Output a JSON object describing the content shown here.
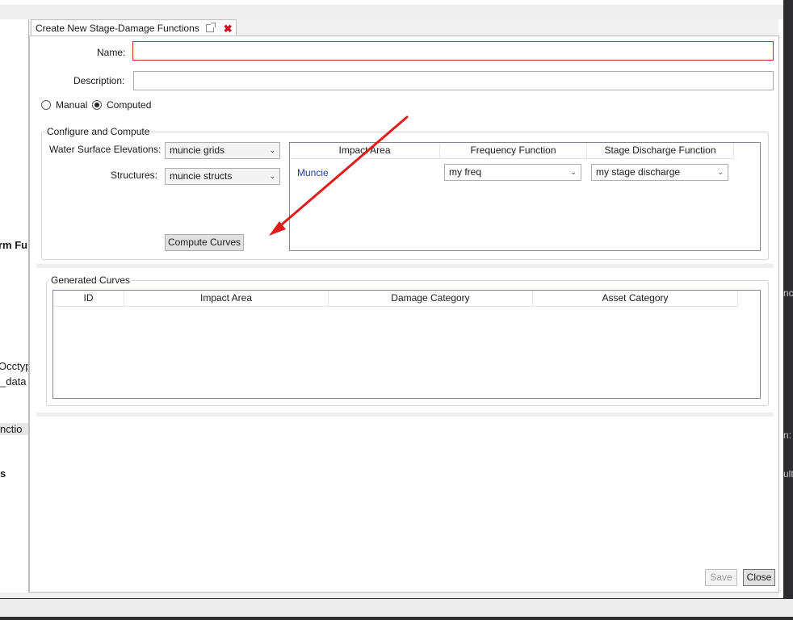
{
  "tab": {
    "title": "Create New Stage-Damage Functions"
  },
  "form": {
    "name_label": "Name:",
    "name_value": "",
    "description_label": "Description:",
    "description_value": "",
    "mode_options": [
      {
        "label": "Manual",
        "selected": false
      },
      {
        "label": "Computed",
        "selected": true
      }
    ]
  },
  "configure": {
    "title": "Configure and Compute",
    "wse_label": "Water Surface Elevations:",
    "wse_value": "muncie grids",
    "structures_label": "Structures:",
    "structures_value": "muncie structs",
    "compute_button": "Compute Curves",
    "table": {
      "columns": [
        "Impact Area",
        "Frequency Function",
        "Stage Discharge Function"
      ],
      "rows": [
        {
          "impact_area": "Muncie",
          "frequency_function": "my freq",
          "stage_discharge": "my stage discharge"
        }
      ]
    }
  },
  "generated": {
    "title": "Generated Curves",
    "columns": [
      "ID",
      "Impact Area",
      "Damage Category",
      "Asset Category"
    ],
    "rows": []
  },
  "footer": {
    "save_label": "Save",
    "close_label": "Close"
  },
  "background": {
    "left_fragments": [
      "rm Fu",
      "Occtyp",
      "_data",
      "nctio",
      "s"
    ],
    "right_fragments": [
      "nc",
      "n:",
      "ult"
    ]
  },
  "colors": {
    "error_border": "#d9232e",
    "annotation_arrow": "#e01b1b",
    "tab_close": "#d0021b"
  }
}
